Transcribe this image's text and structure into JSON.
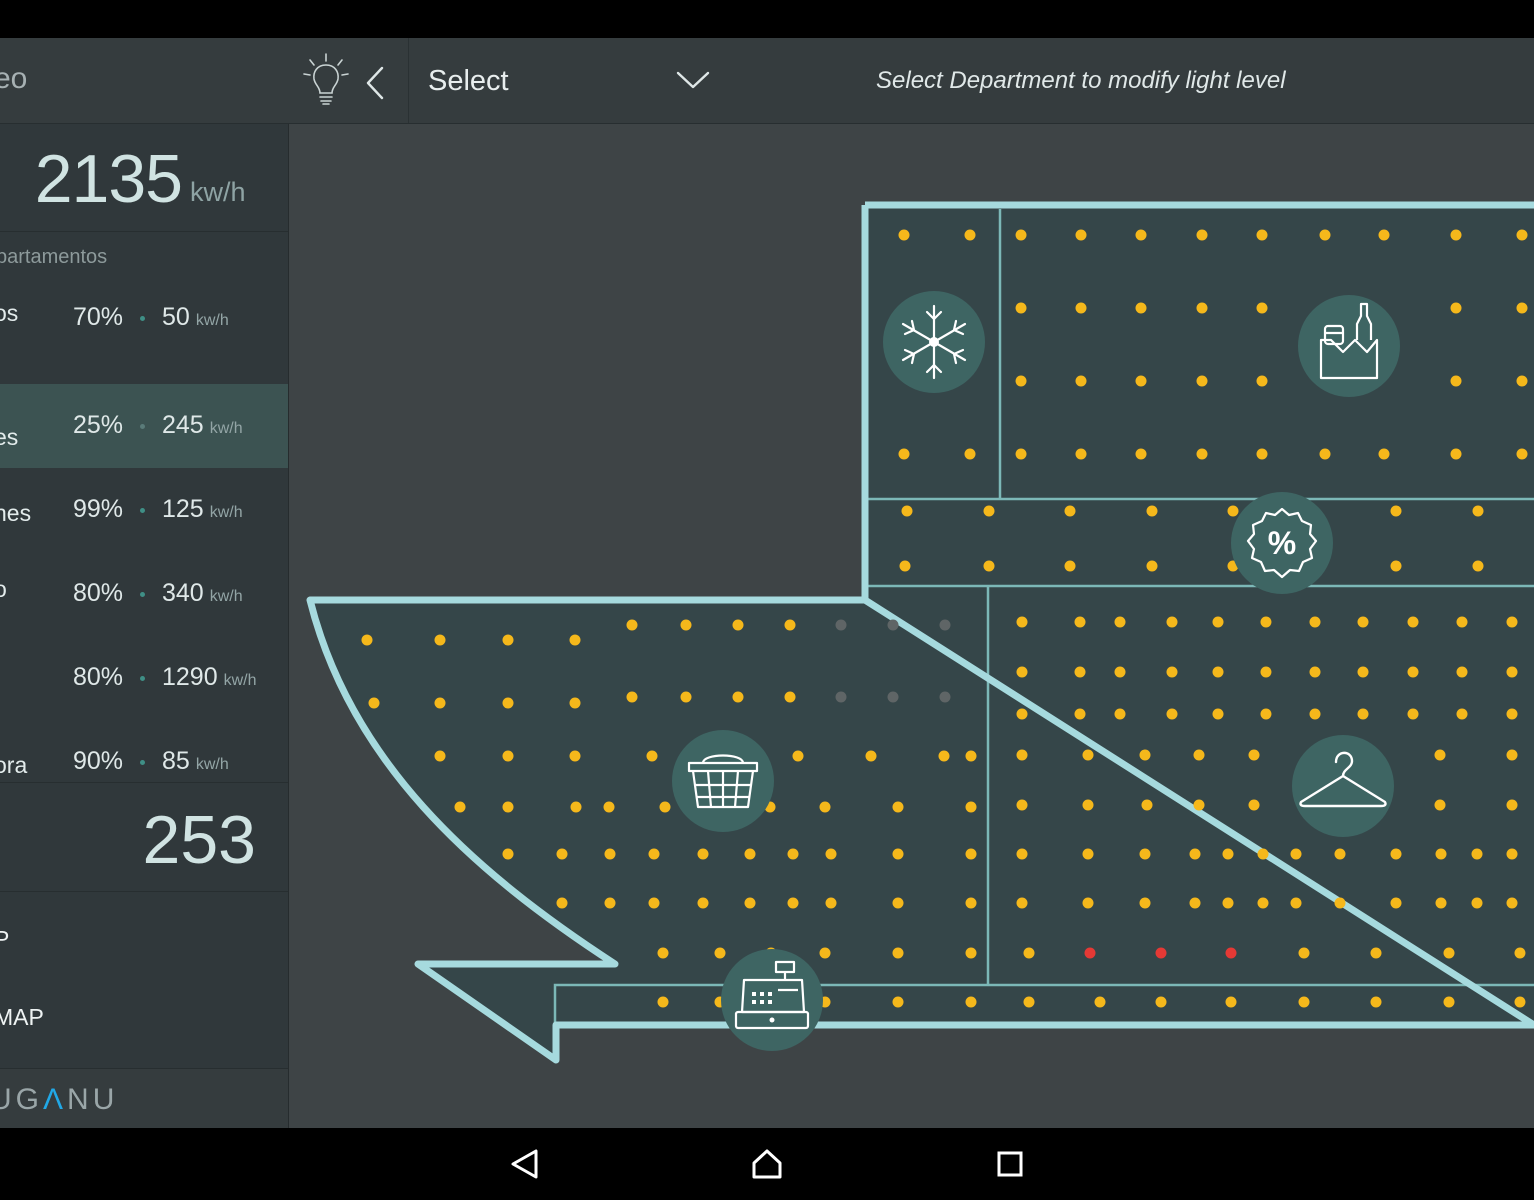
{
  "sidebar": {
    "title_partial": "eo",
    "total": {
      "value": "2135",
      "unit": "kw/h"
    },
    "departments_header": "partamentos",
    "departments": [
      {
        "name": "os",
        "percent": "70%",
        "kwh": "50",
        "unit": "kw/h",
        "active": false
      },
      {
        "name": "es",
        "percent": "25%",
        "kwh": "245",
        "unit": "kw/h",
        "active": true
      },
      {
        "name": "nes",
        "percent": "99%",
        "kwh": "125",
        "unit": "kw/h",
        "active": false
      },
      {
        "name": "o",
        "percent": "80%",
        "kwh": "340",
        "unit": "kw/h",
        "active": false
      },
      {
        "name": "",
        "percent": "80%",
        "kwh": "1290",
        "unit": "kw/h",
        "active": false
      },
      {
        "name": "ora",
        "percent": "90%",
        "kwh": "85",
        "unit": "kw/h",
        "active": false
      }
    ],
    "count": "253",
    "links": [
      "P",
      "MAP"
    ],
    "brand": {
      "prefix": "UG",
      "accent": "Λ",
      "suffix": "NU"
    }
  },
  "topbar": {
    "select_label": "Select",
    "hint": "Select Department to modify light level"
  },
  "map": {
    "icons": [
      "snowflake-icon",
      "grocery-icon",
      "discount-icon",
      "basket-icon",
      "hanger-icon",
      "cash-register-icon"
    ],
    "colors": {
      "light_on": "#f5b81b",
      "light_off": "#5f6566",
      "light_fault": "#e53935",
      "outline": "#a6dade",
      "zone_fill": "#354649",
      "zone_line": "#7cb8b7",
      "icon_circle": "#3e6563"
    }
  },
  "colors": {
    "accent": "#3c5352",
    "brand_accent": "#21a8e6"
  }
}
